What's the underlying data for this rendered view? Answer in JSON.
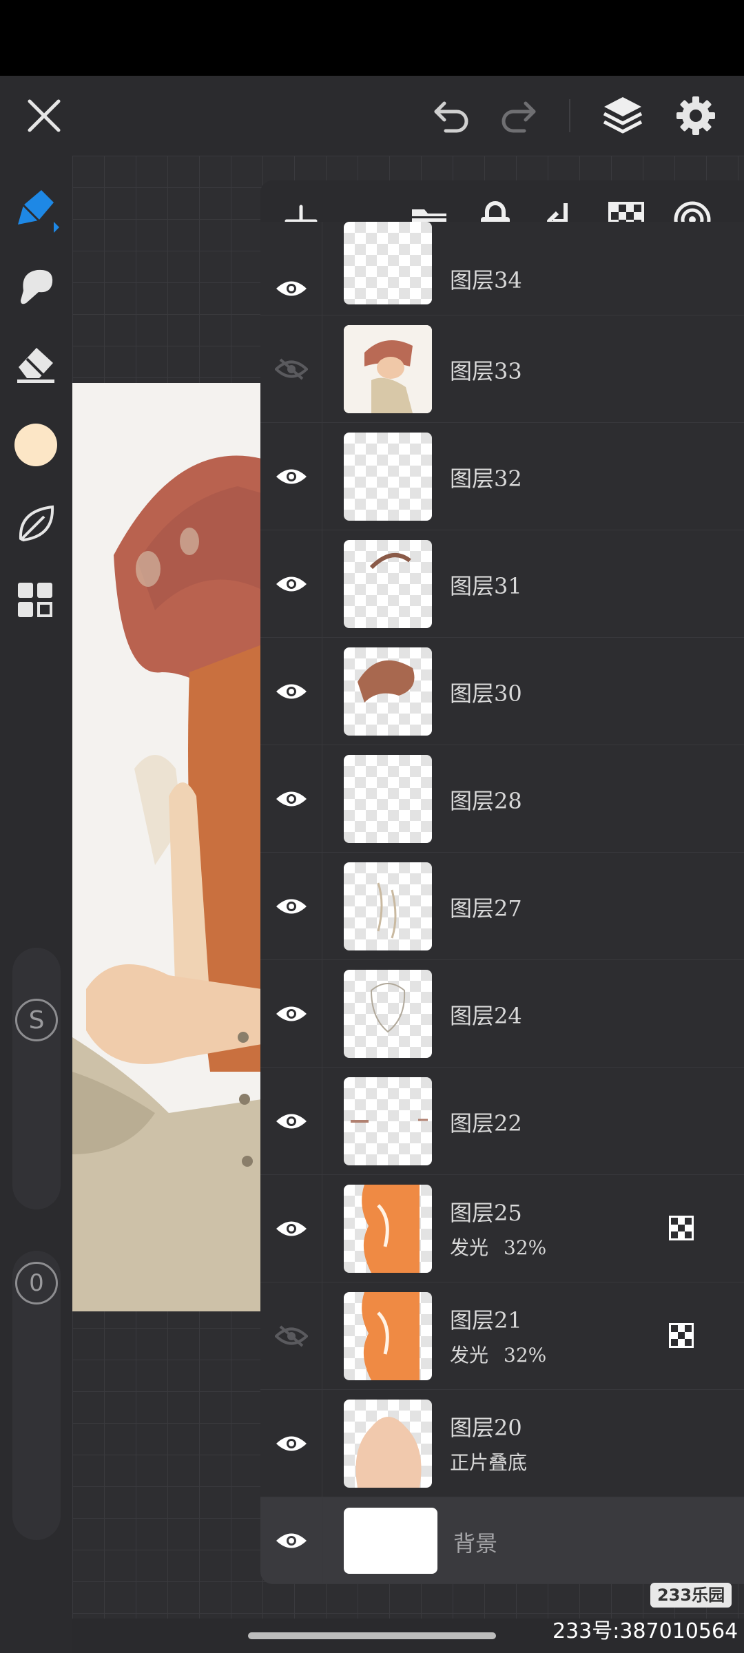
{
  "top_bar": {
    "close_icon": "close-icon",
    "undo_icon": "undo-icon",
    "redo_icon": "redo-icon",
    "layers_icon": "layers-icon",
    "settings_icon": "gear-icon"
  },
  "left_toolbar": {
    "tools": [
      "pen-tool-icon",
      "smudge-tool-icon",
      "eraser-icon",
      "leaf-icon",
      "grid-panel-icon"
    ],
    "active_tool": "pen-tool-icon",
    "accent_color": "#1e88e5",
    "current_color": "#fce6c6",
    "size_label": "S",
    "opacity_label": "0"
  },
  "layers_toolbar": {
    "icons": [
      "add-layer-icon",
      "folder-icon",
      "lock-icon",
      "merge-down-icon",
      "transparency-icon",
      "target-icon"
    ]
  },
  "layers": [
    {
      "name": "图层34",
      "visible": true,
      "blend": "",
      "opacity": "",
      "clipped": false
    },
    {
      "name": "图层33",
      "visible": false,
      "blend": "",
      "opacity": "",
      "clipped": false
    },
    {
      "name": "图层32",
      "visible": true,
      "blend": "",
      "opacity": "",
      "clipped": false
    },
    {
      "name": "图层31",
      "visible": true,
      "blend": "",
      "opacity": "",
      "clipped": false
    },
    {
      "name": "图层30",
      "visible": true,
      "blend": "",
      "opacity": "",
      "clipped": false
    },
    {
      "name": "图层28",
      "visible": true,
      "blend": "",
      "opacity": "",
      "clipped": false
    },
    {
      "name": "图层27",
      "visible": true,
      "blend": "",
      "opacity": "",
      "clipped": false
    },
    {
      "name": "图层24",
      "visible": true,
      "blend": "",
      "opacity": "",
      "clipped": false
    },
    {
      "name": "图层22",
      "visible": true,
      "blend": "",
      "opacity": "",
      "clipped": false
    },
    {
      "name": "图层25",
      "visible": true,
      "blend": "发光",
      "opacity": "32%",
      "clipped": true
    },
    {
      "name": "图层21",
      "visible": false,
      "blend": "发光",
      "opacity": "32%",
      "clipped": true
    },
    {
      "name": "图层20",
      "visible": true,
      "blend": "正片叠底",
      "opacity": "",
      "clipped": false
    },
    {
      "name": "背景",
      "visible": true,
      "blend": "",
      "opacity": "",
      "clipped": false
    }
  ],
  "watermark": {
    "badge": "233乐园",
    "id_text": "233号:387010564"
  }
}
